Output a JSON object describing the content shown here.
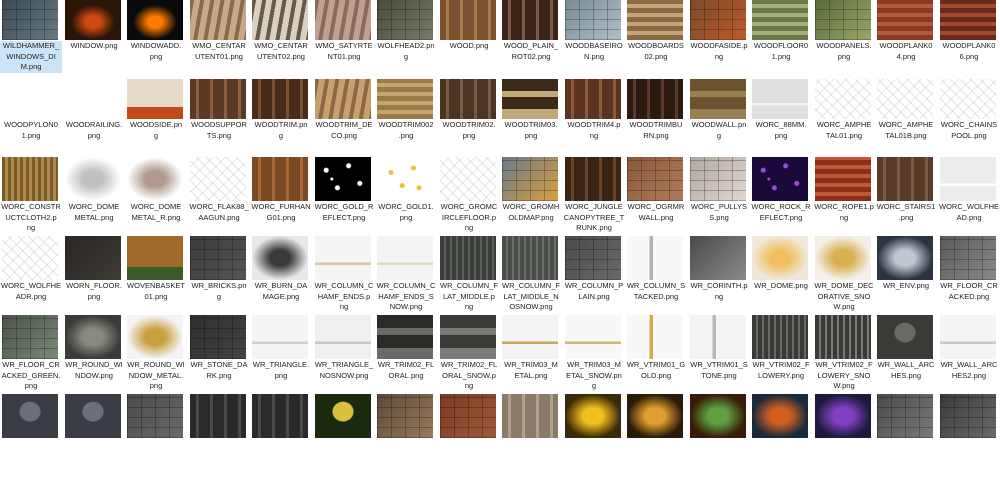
{
  "window_title": "",
  "files": [
    {
      "rows": [
        {
          "lines": [
            "WILDHAMMER_",
            "WINDOWS_DI",
            "M.png"
          ],
          "c1": "#3a4a55",
          "c2": "#6a7a84",
          "p": "stone",
          "sel": true
        },
        {
          "lines": [
            "WINDOW.png"
          ],
          "c1": "#2a1508",
          "c2": "#d24a10",
          "p": "glow"
        },
        {
          "lines": [
            "WINDOWADD.",
            "png"
          ],
          "c1": "#0a0a0a",
          "c2": "#ff7a00",
          "p": "glow"
        },
        {
          "lines": [
            "WMO_CENTAR",
            "UTENT01.png"
          ],
          "c1": "#8a6a4a",
          "c2": "#c8a888",
          "p": "wood"
        },
        {
          "lines": [
            "WMO_CENTAR",
            "UTENT02.png"
          ],
          "c1": "#6a5a4a",
          "c2": "#d8d0c4",
          "p": "wood"
        },
        {
          "lines": [
            "WMO_SATYRTE",
            "NT01.png"
          ],
          "c1": "#8a6a5a",
          "c2": "#c0a090",
          "p": "wood"
        },
        {
          "lines": [
            "WOLFHEAD2.pn",
            "g"
          ],
          "c1": "#4a4a3a",
          "c2": "#7a7a6a",
          "p": "stone"
        },
        {
          "lines": [
            "WOOD.png"
          ],
          "c1": "#7a5230",
          "c2": "#a67a4a",
          "p": "plank"
        },
        {
          "lines": [
            "WOOD_PLAIN_",
            "ROT02.png"
          ],
          "c1": "#3a2418",
          "c2": "#7a5a44",
          "p": "plank"
        },
        {
          "lines": [
            "WOODBASEIRO",
            "N.png"
          ],
          "c1": "#7a8a94",
          "c2": "#b0c0ca",
          "p": "stone"
        },
        {
          "lines": [
            "WOODBOARDS",
            "02.png"
          ],
          "c1": "#8a6a44",
          "c2": "#c8a478",
          "p": "hplank"
        },
        {
          "lines": [
            "WOODFASIDE.p",
            "ng"
          ],
          "c1": "#7a4a2a",
          "c2": "#c05a2a",
          "p": "stone"
        },
        {
          "lines": [
            "WOODFLOOR0",
            "1.png"
          ],
          "c1": "#6a7a4a",
          "c2": "#a8b07a",
          "p": "hplank"
        },
        {
          "lines": [
            "WOODPANELS.",
            "png"
          ],
          "c1": "#5a6a3a",
          "c2": "#9aa86a",
          "p": "stone"
        },
        {
          "lines": [
            "WOODPLANK0",
            "4.png"
          ],
          "c1": "#8a3a24",
          "c2": "#b05a3a",
          "p": "hplank"
        },
        {
          "lines": [
            "WOODPLANK0",
            "6.png"
          ],
          "c1": "#6a2a18",
          "c2": "#a04a30",
          "p": "hplank"
        }
      ]
    },
    {
      "rows": [
        {
          "lines": [
            "WOODPYLON0",
            "1.png"
          ],
          "c1": "#ffffff",
          "c2": "#ffffff",
          "p": "blank"
        },
        {
          "lines": [
            "WOODRAILING.",
            "png"
          ],
          "c1": "#ffffff",
          "c2": "#ffffff",
          "p": "blank"
        },
        {
          "lines": [
            "WOODSIDE.pn",
            "g"
          ],
          "c1": "#e8dac8",
          "c2": "#c04a1a",
          "p": "panel"
        },
        {
          "lines": [
            "WOODSUPPOR",
            "TS.png"
          ],
          "c1": "#5a3a24",
          "c2": "#8a6040",
          "p": "plank"
        },
        {
          "lines": [
            "WOODTRIM.pn",
            "g"
          ],
          "c1": "#4a2a18",
          "c2": "#7a5034",
          "p": "plank"
        },
        {
          "lines": [
            "WOODTRIM_DE",
            "CO.png"
          ],
          "c1": "#8a6a44",
          "c2": "#c8a070",
          "p": "wood"
        },
        {
          "lines": [
            "WOODTRIM002",
            ".png"
          ],
          "c1": "#9a7a4a",
          "c2": "#c8a66a",
          "p": "hplank"
        },
        {
          "lines": [
            "WOODTRIM02.",
            "png"
          ],
          "c1": "#4a3424",
          "c2": "#7a5a40",
          "p": "plank"
        },
        {
          "lines": [
            "WOODTRIM03.",
            "png"
          ],
          "c1": "#3a2a1a",
          "c2": "#c0a878",
          "p": "band"
        },
        {
          "lines": [
            "WOODTRIM4.p",
            "ng"
          ],
          "c1": "#5a3420",
          "c2": "#8a5a3a",
          "p": "plank"
        },
        {
          "lines": [
            "WOODTRIMBU",
            "RN.png"
          ],
          "c1": "#2a1a10",
          "c2": "#5a3a28",
          "p": "plank"
        },
        {
          "lines": [
            "WOODWALL.pn",
            "g"
          ],
          "c1": "#6a5430",
          "c2": "#9a8050",
          "p": "band"
        },
        {
          "lines": [
            "WORC_88MM.",
            "png"
          ],
          "c1": "#e0e0e0",
          "c2": "#f4f4f4",
          "p": "white"
        },
        {
          "lines": [
            "WORC_AMPHE",
            "TAL01.png"
          ],
          "c1": "#e4e4e4",
          "c2": "#ffffff",
          "p": "sketch"
        },
        {
          "lines": [
            "WORC_AMPHE",
            "TAL01B.png"
          ],
          "c1": "#e4e4e4",
          "c2": "#ffffff",
          "p": "sketch"
        },
        {
          "lines": [
            "WORC_CHAINS",
            "POOL.png"
          ],
          "c1": "#eeeeee",
          "c2": "#ffffff",
          "p": "sketch"
        }
      ]
    },
    {
      "rows": [
        {
          "lines": [
            "WORC_CONSTR",
            "UCTCLOTH2.p",
            "ng"
          ],
          "c1": "#7a5a2a",
          "c2": "#b08a4a",
          "p": "cloth"
        },
        {
          "lines": [
            "WORC_DOME",
            "METAL.png"
          ],
          "c1": "#ffffff",
          "c2": "#c0c0c0",
          "p": "blob"
        },
        {
          "lines": [
            "WORC_DOME",
            "METAL_R.png"
          ],
          "c1": "#ffffff",
          "c2": "#b09a90",
          "p": "blob"
        },
        {
          "lines": [
            "WORC_FLAK88_",
            "AAGUN.png"
          ],
          "c1": "#ececec",
          "c2": "#ffffff",
          "p": "sketch"
        },
        {
          "lines": [
            "WORC_FURHAN",
            "G01.png"
          ],
          "c1": "#7a4a24",
          "c2": "#a66a3a",
          "p": "plank"
        },
        {
          "lines": [
            "WORC_GOLD_R",
            "EFLECT.png"
          ],
          "c1": "#000000",
          "c2": "#ffffff",
          "p": "dots"
        },
        {
          "lines": [
            "WORC_GOLD1.",
            "png"
          ],
          "c1": "#ffffff",
          "c2": "#e8c040",
          "p": "ldots"
        },
        {
          "lines": [
            "WORC_GROMC",
            "IRCLEFLOOR.p",
            "ng"
          ],
          "c1": "#e4e4e4",
          "c2": "#ffffff",
          "p": "sketch"
        },
        {
          "lines": [
            "WORC_GROMH",
            "OLDMAP.png"
          ],
          "c1": "#6a7a8a",
          "c2": "#d8a040",
          "p": "stone"
        },
        {
          "lines": [
            "WORC_JUNGLE",
            "CANOPYTREE_T",
            "RUNK.png"
          ],
          "c1": "#3a2414",
          "c2": "#6a4428",
          "p": "plank"
        },
        {
          "lines": [
            "WORC_OGRMR",
            "WALL.png"
          ],
          "c1": "#8a5a3a",
          "c2": "#b07a5a",
          "p": "stone"
        },
        {
          "lines": [
            "WORC_PULLYS",
            "S.png"
          ],
          "c1": "#b0a8a0",
          "c2": "#e0d8d0",
          "p": "stone"
        },
        {
          "lines": [
            "WORC_ROCK_R",
            "EFLECT.png"
          ],
          "c1": "#1a0a3a",
          "c2": "#9a4ae0",
          "p": "dots"
        },
        {
          "lines": [
            "WORC_ROPE1.p",
            "ng"
          ],
          "c1": "#8a3018",
          "c2": "#c0583a",
          "p": "hplank"
        },
        {
          "lines": [
            "WORC_STAIRS1",
            ".png"
          ],
          "c1": "#5a3a28",
          "c2": "#7a5a44",
          "p": "plank"
        },
        {
          "lines": [
            "WORC_WOLFHE",
            "AD.png"
          ],
          "c1": "#ececec",
          "c2": "#ffffff",
          "p": "white"
        }
      ]
    },
    {
      "rows": [
        {
          "lines": [
            "WORC_WOLFHE",
            "ADR.png"
          ],
          "c1": "#d8d8d8",
          "c2": "#ffffff",
          "p": "sketch"
        },
        {
          "lines": [
            "WORN_FLOOR.",
            "png"
          ],
          "c1": "#2a2624",
          "c2": "#3e3a36",
          "p": "dark"
        },
        {
          "lines": [
            "WOVENBASKET",
            "01.png"
          ],
          "c1": "#a06a2a",
          "c2": "#3a5a2a",
          "p": "panel"
        },
        {
          "lines": [
            "WR_BRICKS.pn",
            "g"
          ],
          "c1": "#3a3a3a",
          "c2": "#555555",
          "p": "stone"
        },
        {
          "lines": [
            "WR_BURN_DA",
            "MAGE.png"
          ],
          "c1": "#e8e8e8",
          "c2": "#3a3a3a",
          "p": "blob"
        },
        {
          "lines": [
            "WR_COLUMN_C",
            "HAMF_ENDS.p",
            "ng"
          ],
          "c1": "#f4f4f4",
          "c2": "#d8c8a0",
          "p": "white"
        },
        {
          "lines": [
            "WR_COLUMN_C",
            "HAMF_ENDS_S",
            "NOW.png"
          ],
          "c1": "#f4f4f4",
          "c2": "#e0d8c8",
          "p": "white"
        },
        {
          "lines": [
            "WR_COLUMN_F",
            "LAT_MIDDLE.p",
            "ng"
          ],
          "c1": "#3a3e38",
          "c2": "#5a5e58",
          "p": "col"
        },
        {
          "lines": [
            "WR_COLUMN_F",
            "LAT_MIDDLE_N",
            "OSNOW.png"
          ],
          "c1": "#4a4e48",
          "c2": "#6a6e68",
          "p": "col"
        },
        {
          "lines": [
            "WR_COLUMN_P",
            "LAIN.png"
          ],
          "c1": "#4a4a48",
          "c2": "#6a6a68",
          "p": "stone"
        },
        {
          "lines": [
            "WR_COLUMN_S",
            "TACKED.png"
          ],
          "c1": "#f8f8f8",
          "c2": "#b0b0b0",
          "p": "col2"
        },
        {
          "lines": [
            "WR_CORINTH.p",
            "ng"
          ],
          "c1": "#4a4a48",
          "c2": "#8a8a88",
          "p": "dark"
        },
        {
          "lines": [
            "WR_DOME.png"
          ],
          "c1": "#f0e8d8",
          "c2": "#f0c060",
          "p": "blob"
        },
        {
          "lines": [
            "WR_DOME_DEC",
            "ORATIVE_SNO",
            "W.png"
          ],
          "c1": "#f4f0e8",
          "c2": "#d8b050",
          "p": "blob"
        },
        {
          "lines": [
            "WR_ENV.png"
          ],
          "c1": "#2a3440",
          "c2": "#c0c8d0",
          "p": "blob"
        },
        {
          "lines": [
            "WR_FLOOR_CR",
            "ACKED.png"
          ],
          "c1": "#5a5a58",
          "c2": "#8a8a88",
          "p": "stone"
        }
      ]
    },
    {
      "rows": [
        {
          "lines": [
            "WR_FLOOR_CR",
            "ACKED_GREEN.",
            "png"
          ],
          "c1": "#4a5248",
          "c2": "#7a8a78",
          "p": "stone"
        },
        {
          "lines": [
            "WR_ROUND_WI",
            "NDOW.png"
          ],
          "c1": "#3a3a38",
          "c2": "#8a8a80",
          "p": "blob"
        },
        {
          "lines": [
            "WR_ROUND_WI",
            "NDOW_METAL.",
            "png"
          ],
          "c1": "#f4f4f4",
          "c2": "#c8a040",
          "p": "blob"
        },
        {
          "lines": [
            "WR_STONE_DA",
            "RK.png"
          ],
          "c1": "#2e2e2e",
          "c2": "#444444",
          "p": "stone"
        },
        {
          "lines": [
            "WR_TRIANGLE.",
            "png"
          ],
          "c1": "#f4f4f4",
          "c2": "#d0d0d0",
          "p": "white"
        },
        {
          "lines": [
            "WR_TRIANGLE_",
            "NOSNOW.png"
          ],
          "c1": "#f0f0f0",
          "c2": "#c8c8c8",
          "p": "white"
        },
        {
          "lines": [
            "WR_TRIM02_FL",
            "ORAL.png"
          ],
          "c1": "#2a2a28",
          "c2": "#6a6a66",
          "p": "band"
        },
        {
          "lines": [
            "WR_TRIM02_FL",
            "ORAL_SNOW.p",
            "ng"
          ],
          "c1": "#3a3a38",
          "c2": "#7a7a76",
          "p": "band"
        },
        {
          "lines": [
            "WR_TRIM03_M",
            "ETAL.png"
          ],
          "c1": "#f4f4f4",
          "c2": "#c8a858",
          "p": "white"
        },
        {
          "lines": [
            "WR_TRIM03_M",
            "ETAL_SNOW.pn",
            "g"
          ],
          "c1": "#f8f8f8",
          "c2": "#d0b878",
          "p": "white"
        },
        {
          "lines": [
            "WR_VTRIM01_G",
            "OLD.png"
          ],
          "c1": "#f8f8f8",
          "c2": "#d8a848",
          "p": "col2"
        },
        {
          "lines": [
            "WR_VTRIM01_S",
            "TONE.png"
          ],
          "c1": "#f4f4f4",
          "c2": "#b8b8b8",
          "p": "col2"
        },
        {
          "lines": [
            "WR_VTRIM02_F",
            "LOWERY.png"
          ],
          "c1": "#3a3a36",
          "c2": "#6a6a64",
          "p": "col"
        },
        {
          "lines": [
            "WR_VTRIM02_F",
            "LOWERY_SNO",
            "W.png"
          ],
          "c1": "#3a3a36",
          "c2": "#7a7a74",
          "p": "col"
        },
        {
          "lines": [
            "WR_WALL_ARC",
            "HES.png"
          ],
          "c1": "#3a3a36",
          "c2": "#6a6a64",
          "p": "arch"
        },
        {
          "lines": [
            "WR_WALL_ARC",
            "HES2.png"
          ],
          "c1": "#f4f4f4",
          "c2": "#c8c8c8",
          "p": "white"
        }
      ]
    },
    {
      "rows": [
        {
          "lines": [],
          "c1": "#3a3e44",
          "c2": "#6a7078",
          "p": "arch"
        },
        {
          "lines": [],
          "c1": "#3a3e44",
          "c2": "#6a7078",
          "p": "arch"
        },
        {
          "lines": [],
          "c1": "#4a4a48",
          "c2": "#6a6a68",
          "p": "stone"
        },
        {
          "lines": [],
          "c1": "#2a2a2a",
          "c2": "#4a4a4a",
          "p": "plank"
        },
        {
          "lines": [],
          "c1": "#2a2a2a",
          "c2": "#4a4a4a",
          "p": "plank"
        },
        {
          "lines": [],
          "c1": "#1a2a10",
          "c2": "#d8c040",
          "p": "arch"
        },
        {
          "lines": [],
          "c1": "#5a4a3a",
          "c2": "#9a7a5a",
          "p": "stone"
        },
        {
          "lines": [],
          "c1": "#7a3a24",
          "c2": "#a05a3a",
          "p": "stone"
        },
        {
          "lines": [],
          "c1": "#8a7a6a",
          "c2": "#b0a090",
          "p": "plank"
        },
        {
          "lines": [],
          "c1": "#3a2a08",
          "c2": "#f0c020",
          "p": "blob"
        },
        {
          "lines": [],
          "c1": "#2a1a08",
          "c2": "#e0a030",
          "p": "blob"
        },
        {
          "lines": [],
          "c1": "#3a1a08",
          "c2": "#60a040",
          "p": "blob"
        },
        {
          "lines": [],
          "c1": "#1a2a3a",
          "c2": "#d06020",
          "p": "blob"
        },
        {
          "lines": [],
          "c1": "#1a1a3a",
          "c2": "#8040c0",
          "p": "blob"
        },
        {
          "lines": [],
          "c1": "#4a4a4a",
          "c2": "#7a7a7a",
          "p": "stone"
        },
        {
          "lines": [],
          "c1": "#3a3a3a",
          "c2": "#6a6a6a",
          "p": "stone"
        }
      ]
    }
  ]
}
